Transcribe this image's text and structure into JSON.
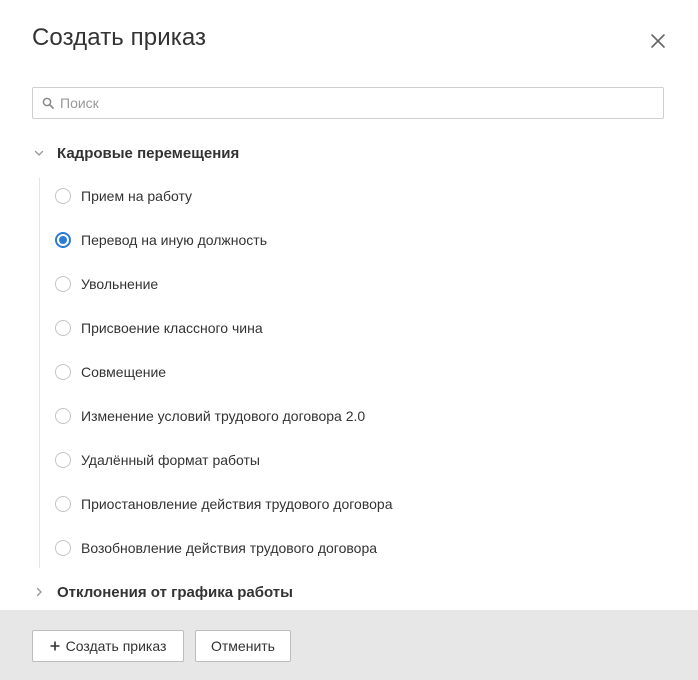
{
  "dialog": {
    "title": "Создать приказ",
    "close_icon": "close-icon"
  },
  "search": {
    "placeholder": "Поиск",
    "value": "",
    "icon": "search-icon"
  },
  "groups": [
    {
      "label": "Кадровые перемещения",
      "expanded": true,
      "items": [
        {
          "label": "Прием на работу",
          "selected": false
        },
        {
          "label": "Перевод на иную должность",
          "selected": true
        },
        {
          "label": "Увольнение",
          "selected": false
        },
        {
          "label": "Присвоение классного чина",
          "selected": false
        },
        {
          "label": "Совмещение",
          "selected": false
        },
        {
          "label": "Изменение условий трудового договора 2.0",
          "selected": false
        },
        {
          "label": "Удалённый формат работы",
          "selected": false
        },
        {
          "label": "Приостановление действия трудового договора",
          "selected": false
        },
        {
          "label": "Возобновление действия трудового договора",
          "selected": false
        }
      ]
    },
    {
      "label": "Отклонения от графика работы",
      "expanded": false
    }
  ],
  "footer": {
    "create_label": "Создать приказ",
    "cancel_label": "Отменить"
  },
  "colors": {
    "accent": "#2b7cd3",
    "footer_bg": "#e7e7e7",
    "text": "#333333"
  }
}
